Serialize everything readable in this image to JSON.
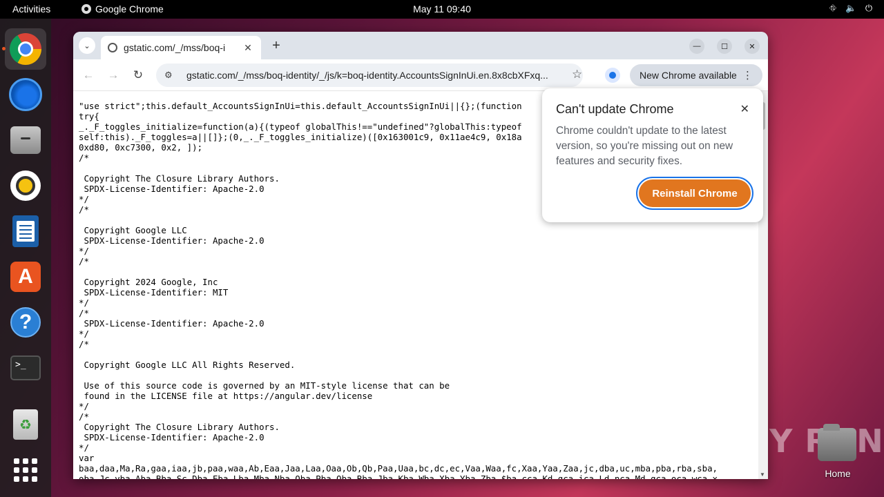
{
  "topbar": {
    "activities": "Activities",
    "app_name": "Google Chrome",
    "clock": "May 11  09:40"
  },
  "dock": {
    "items": [
      {
        "name": "Google Chrome",
        "icon": "chrome-icon"
      },
      {
        "name": "Thunderbird",
        "icon": "thunderbird-icon"
      },
      {
        "name": "Files",
        "icon": "files-icon"
      },
      {
        "name": "Rhythmbox",
        "icon": "rhythmbox-icon"
      },
      {
        "name": "LibreOffice Writer",
        "icon": "writer-icon"
      },
      {
        "name": "App Center",
        "icon": "app-store-icon"
      },
      {
        "name": "Help",
        "icon": "help-icon"
      },
      {
        "name": "Terminal",
        "icon": "terminal-icon"
      },
      {
        "name": "Trash",
        "icon": "trash-icon"
      },
      {
        "name": "Show Apps",
        "icon": "app-grid-icon"
      }
    ],
    "store_glyph": "A",
    "help_glyph": "?",
    "term_glyph": ">_",
    "trash_glyph": "♻"
  },
  "desktop": {
    "home_label": "Home",
    "watermark": "ANY RUN"
  },
  "browser": {
    "tab_title": "gstatic.com/_/mss/boq-i",
    "url": "gstatic.com/_/mss/boq-identity/_/js/k=boq-identity.AccountsSignInUi.en.8x8cbXFxq...",
    "update_button": "New Chrome available",
    "source_lines": [
      "\"use strict\";this.default_AccountsSignInUi=this.default_AccountsSignInUi||{};(function",
      "try{",
      "_._F_toggles_initialize=function(a){(typeof globalThis!==\"undefined\"?globalThis:typeof",
      "self:this)._F_toggles=a||[]};(0,_._F_toggles_initialize)([0x163001c9, 0x11ae4c9, 0x18a",
      "0xd80, 0xc7300, 0x2, ]);",
      "/*",
      "",
      " Copyright The Closure Library Authors.",
      " SPDX-License-Identifier: Apache-2.0",
      "*/",
      "/*",
      "",
      " Copyright Google LLC",
      " SPDX-License-Identifier: Apache-2.0",
      "*/",
      "/*",
      "",
      " Copyright 2024 Google, Inc",
      " SPDX-License-Identifier: MIT",
      "*/",
      "/*",
      " SPDX-License-Identifier: Apache-2.0",
      "*/",
      "/*",
      "",
      " Copyright Google LLC All Rights Reserved.",
      "",
      " Use of this source code is governed by an MIT-style license that can be",
      " found in the LICENSE file at https://angular.dev/license",
      "*/",
      "/*",
      " Copyright The Closure Library Authors.",
      " SPDX-License-Identifier: Apache-2.0",
      "*/",
      "var",
      "baa,daa,Ma,Ra,gaa,iaa,jb,paa,waa,Ab,Eaa,Jaa,Laa,Oaa,Ob,Qb,Paa,Uaa,bc,dc,ec,Vaa,Waa,fc,Xaa,Yaa,Zaa,jc,dba,uc,mba,pba,rba,sba,",
      "oba,Jc,vba,Aba,Bba,Sc,Dba,Eba,Lba,Mba,Nba,Oba,Pba,Qba,Rba,Jba,Kba,Wba,Xba,Yba,Zba,$ba,cca,Kd,gca,ica,Ld,nca,Md,qca,oca,wca,x"
    ]
  },
  "popup": {
    "title": "Can't update Chrome",
    "body": "Chrome couldn't update to the latest version, so you're missing out on new features and security fixes.",
    "action": "Reinstall Chrome"
  }
}
